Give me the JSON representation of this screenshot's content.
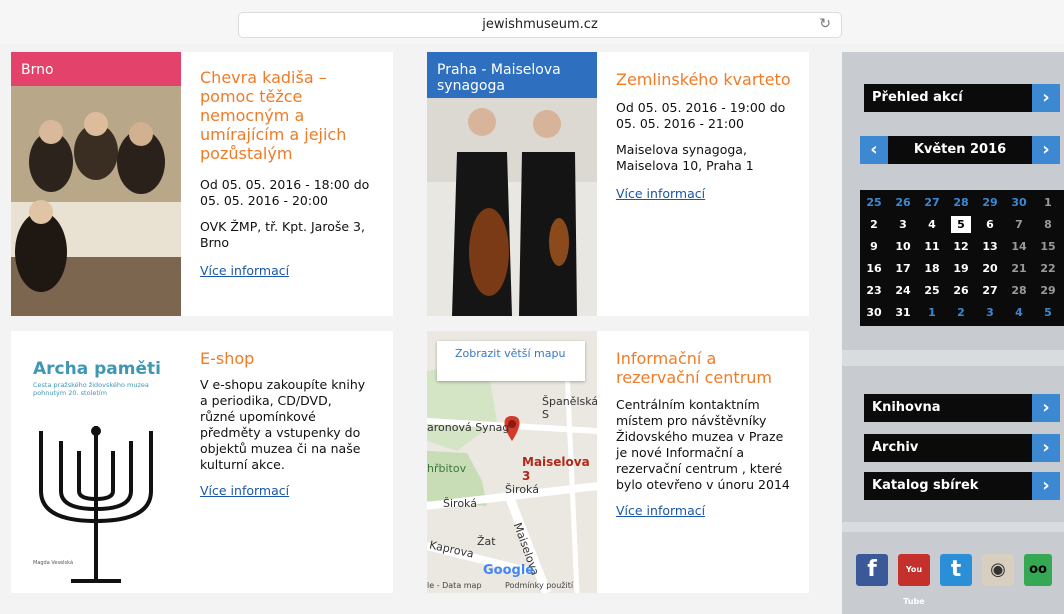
{
  "browser": {
    "url": "jewishmuseum.cz"
  },
  "events": [
    {
      "tag": "Brno",
      "title": "Chevra kadiša – pomoc těžce nemocným a umírajícím a jejich pozůstalým",
      "date": "Od 05. 05. 2016 - 18:00 do 05. 05. 2016 - 20:00",
      "place": "OVK ŽMP, tř. Kpt. Jaroše 3, Brno",
      "more": "Více informací"
    },
    {
      "tag": "Praha - Maiselova synagoga",
      "title": "Zemlinského kvarteto",
      "date": "Od 05. 05. 2016 - 19:00 do 05. 05. 2016 - 21:00",
      "place": "Maiselova synagoga, Maiselova 10, Praha 1",
      "more": "Více informací"
    }
  ],
  "eshop": {
    "book_title": "Archa paměti",
    "book_subtitle": "Cesta pražského židovského muzea pohnutým 20. stoletím",
    "book_author": "Magda Veselská",
    "title": "E-shop",
    "text": "V e-shopu zakoupíte knihy a periodika, CD/DVD, různé upomínkové předměty a vstupenky do objektů muzea či na naše kulturní akce.",
    "more": "Více informací"
  },
  "info": {
    "map_link": "Zobrazit větší mapu",
    "map_labels": [
      "Španělská S",
      "aronová Synag",
      "Maiselova 3",
      "hřbitov",
      "Široká",
      "Široká",
      "Maiselova",
      "Kaprova",
      "Žat",
      "Google",
      "le - Data map",
      "Podmínky použití"
    ],
    "title": "Informační a rezervační centrum",
    "text": "Centrálním kontaktním místem pro návštěvníky Židovského muzea v Praze je nové Informační a rezervační centrum , které bylo otevřeno v únoru 2014",
    "more": "Více informací"
  },
  "sidebar": {
    "overview": "Přehled akcí",
    "month": "Květen 2016",
    "prev": "‹",
    "next": "›",
    "arrow": "›",
    "calendar": [
      [
        "25",
        "26",
        "27",
        "28",
        "29",
        "30",
        "1"
      ],
      [
        "2",
        "3",
        "4",
        "5",
        "6",
        "7",
        "8"
      ],
      [
        "9",
        "10",
        "11",
        "12",
        "13",
        "14",
        "15"
      ],
      [
        "16",
        "17",
        "18",
        "19",
        "20",
        "21",
        "22"
      ],
      [
        "23",
        "24",
        "25",
        "26",
        "27",
        "28",
        "29"
      ],
      [
        "30",
        "31",
        "1",
        "2",
        "3",
        "4",
        "5"
      ]
    ],
    "links": [
      "Knihovna",
      "Archiv",
      "Katalog sbírek"
    ],
    "social": [
      "f",
      "You Tube",
      "t",
      "◉",
      "oo"
    ],
    "social_icons": [
      "facebook-icon",
      "youtube-icon",
      "twitter-icon",
      "instagram-icon",
      "tripadvisor-icon"
    ],
    "colors": {
      "accent": "#3c89d1",
      "orange": "#f07b26",
      "brno": "#e3436b",
      "praha": "#2e6fc0"
    }
  }
}
